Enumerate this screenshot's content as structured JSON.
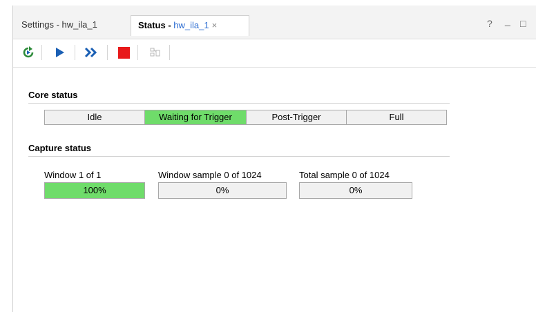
{
  "tabs": [
    {
      "label": "Settings - hw_ila_1"
    },
    {
      "label_prefix": "Status - ",
      "label_name": "hw_ila_1",
      "close": "×"
    }
  ],
  "window_controls": {
    "help": "?",
    "minimize": "_",
    "maximize": "□"
  },
  "toolbar": {
    "icons": [
      "run-trigger-immediate-icon",
      "run-trigger-icon",
      "run-trigger-continuous-icon",
      "stop-trigger-icon",
      "export-icon"
    ]
  },
  "core_status": {
    "title": "Core status",
    "states": [
      "Idle",
      "Waiting for Trigger",
      "Post-Trigger",
      "Full"
    ],
    "active_index": 1
  },
  "capture_status": {
    "title": "Capture status",
    "window": {
      "label": "Window 1 of 1",
      "value_text": "100%",
      "progress": 1.0
    },
    "window_sample": {
      "label": "Window sample 0 of 1024",
      "value_text": "0%",
      "progress": 0.0
    },
    "total_sample": {
      "label": "Total sample 0 of 1024",
      "value_text": "0%",
      "progress": 0.0
    }
  },
  "colors": {
    "active_green": "#6fdc6a",
    "accent_blue": "#2a6bd1",
    "stop_red": "#e8191a",
    "run_blue": "#1a5fb4",
    "refresh_green": "#2e8b3a"
  }
}
